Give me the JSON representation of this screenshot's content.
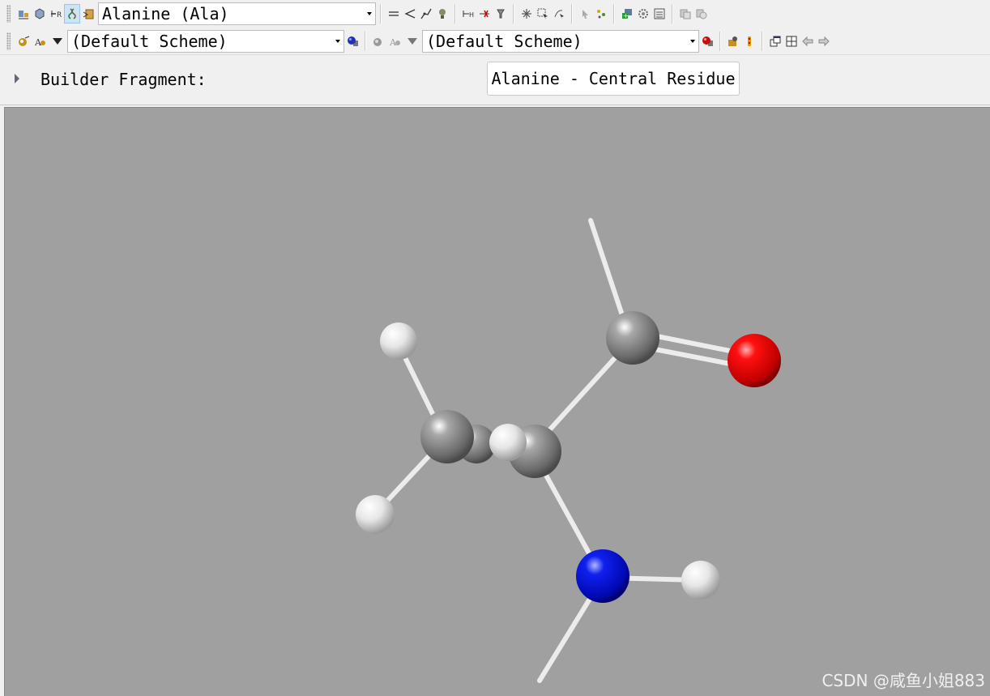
{
  "toolbar1": {
    "fragment_combo": "Alanine (Ala)"
  },
  "toolbar2": {
    "scheme_combo_left": "(Default Scheme)",
    "scheme_combo_right": "(Default Scheme)"
  },
  "builder": {
    "label": "Builder Fragment:",
    "fragment_name": "Alanine - Central Residue"
  },
  "viewport": {
    "background": "#a0a0a0",
    "element_colors": {
      "carbon": "#8c8c8c",
      "hydrogen": "#e8e8e8",
      "oxygen": "#e00000",
      "nitrogen": "#0010cc"
    }
  },
  "watermark": "CSDN @咸鱼小姐883"
}
